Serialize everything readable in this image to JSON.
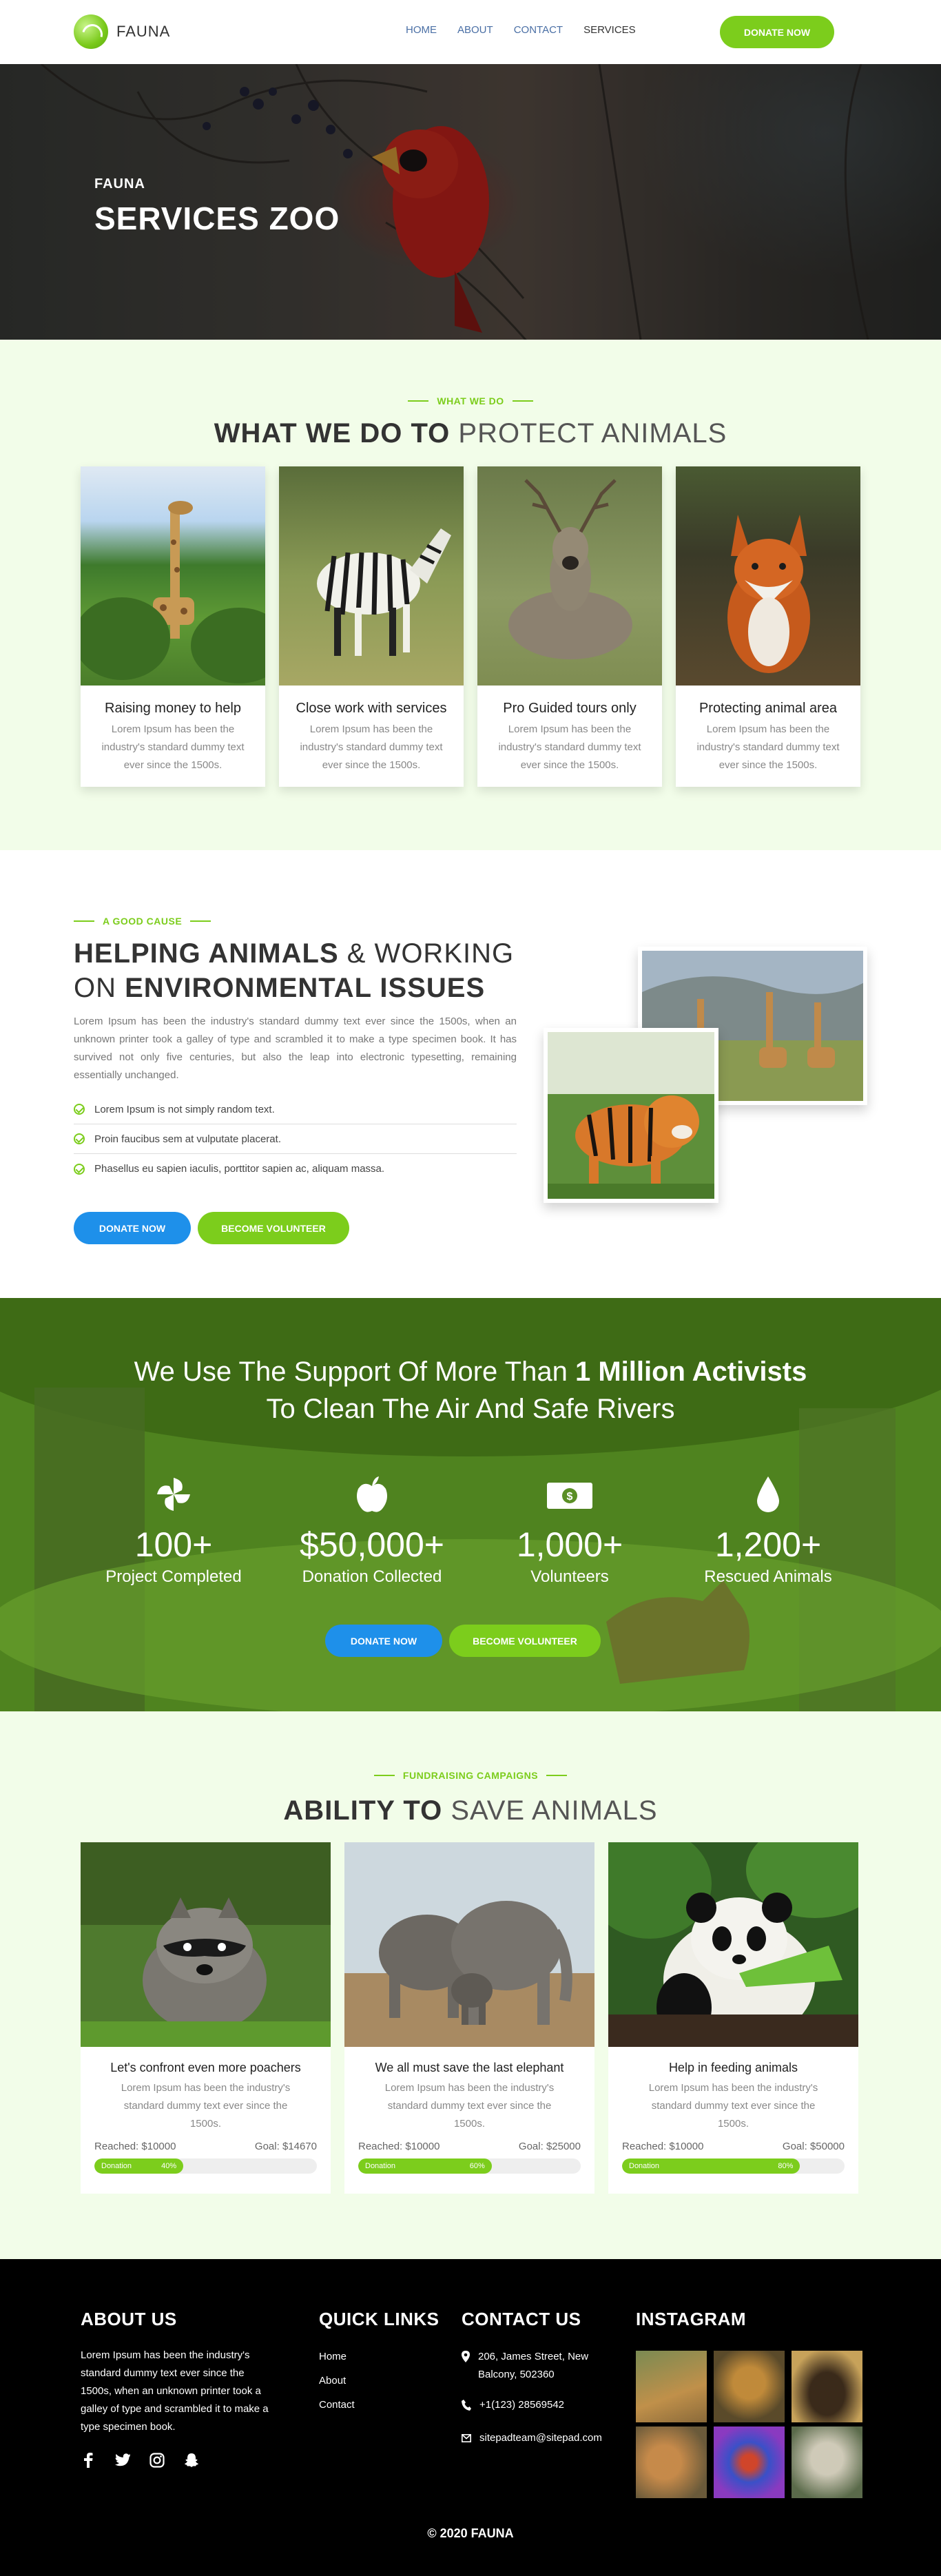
{
  "nav": {
    "brand": "FAUNA",
    "menu": [
      "HOME",
      "ABOUT",
      "CONTACT",
      "SERVICES"
    ],
    "active": "SERVICES",
    "cta": "DONATE NOW"
  },
  "hero": {
    "small": "FAUNA",
    "title": "SERVICES ZOO"
  },
  "what_we_do": {
    "eyebrow": "WHAT WE DO",
    "title_bold": "WHAT WE DO TO",
    "title_light": "PROTECT ANIMALS",
    "cards": [
      {
        "title": "Raising money to help",
        "text": "Lorem Ipsum has been the industry's standard dummy text ever since the 1500s."
      },
      {
        "title": "Close work with services",
        "text": "Lorem Ipsum has been the industry's standard dummy text ever since the 1500s."
      },
      {
        "title": "Pro Guided tours only",
        "text": "Lorem Ipsum has been the industry's standard dummy text ever since the 1500s."
      },
      {
        "title": "Protecting animal area",
        "text": "Lorem Ipsum has been the industry's standard dummy text ever since the 1500s."
      }
    ]
  },
  "cause": {
    "eyebrow": "A GOOD CAUSE",
    "line1_bold": "HELPING ANIMALS",
    "line1_light": "& WORKING",
    "line2_light": "ON",
    "line2_bold": "ENVIRONMENTAL ISSUES",
    "paragraph": "Lorem Ipsum has been the industry's standard dummy text ever since the 1500s, when an unknown printer took a galley of type and scrambled it to make a type specimen book. It has survived not only five centuries, but also the leap into electronic typesetting, remaining essentially unchanged.",
    "checks": [
      "Lorem Ipsum is not simply random text.",
      "Proin faucibus sem at vulputate placerat.",
      "Phasellus eu sapien iaculis, porttitor sapien ac, aliquam massa."
    ],
    "btn_donate": "DONATE NOW",
    "btn_volunteer": "BECOME VOLUNTEER"
  },
  "support": {
    "line1_light": "We Use The Support Of More Than",
    "line1_bold": "1 Million Activists",
    "line2": "To Clean The Air And Safe Rivers",
    "stats": [
      {
        "icon": "pinwheel-icon",
        "value": "100+",
        "label": "Project Completed"
      },
      {
        "icon": "apple-icon",
        "value": "$50,000+",
        "label": "Donation Collected"
      },
      {
        "icon": "money-icon",
        "value": "1,000+",
        "label": "Volunteers"
      },
      {
        "icon": "drop-icon",
        "value": "1,200+",
        "label": "Rescued Animals"
      }
    ],
    "btn_donate": "DONATE NOW",
    "btn_volunteer": "BECOME VOLUNTEER"
  },
  "fundraising": {
    "eyebrow": "FUNDRAISING CAMPAIGNS",
    "title_bold": "ABILITY TO",
    "title_light": "SAVE ANIMALS",
    "cards": [
      {
        "title": "Let's confront even more poachers",
        "text": "Lorem Ipsum has been the industry's standard dummy text ever since the 1500s.",
        "reached": "Reached: $10000",
        "goal": "Goal: $14670",
        "bar_label": "Donation",
        "percent_label": "40%",
        "percent": 0.4
      },
      {
        "title": "We all must save the last elephant",
        "text": "Lorem Ipsum has been the industry's standard dummy text ever since the 1500s.",
        "reached": "Reached: $10000",
        "goal": "Goal: $25000",
        "bar_label": "Donation",
        "percent_label": "60%",
        "percent": 0.6
      },
      {
        "title": "Help in feeding animals",
        "text": "Lorem Ipsum has been the industry's standard dummy text ever since the 1500s.",
        "reached": "Reached: $10000",
        "goal": "Goal: $50000",
        "bar_label": "Donation",
        "percent_label": "80%",
        "percent": 0.8
      }
    ]
  },
  "footer": {
    "about_title": "ABOUT US",
    "about_text": "Lorem Ipsum has been the industry's standard dummy text ever since the 1500s, when an unknown printer took a galley of type and scrambled it to make a type specimen book.",
    "links_title": "QUICK LINKS",
    "links": [
      "Home",
      "About",
      "Contact"
    ],
    "contact_title": "CONTACT US",
    "address": "206, James Street, New Balcony, 502360",
    "phone": "+1(123) 28569542",
    "email": "sitepadteam@sitepad.com",
    "insta_title": "INSTAGRAM",
    "copyright": "© 2020 FAUNA"
  },
  "colors": {
    "green": "#7ccd1c",
    "blue": "#1e90ea",
    "mint": "#f2fde9"
  }
}
